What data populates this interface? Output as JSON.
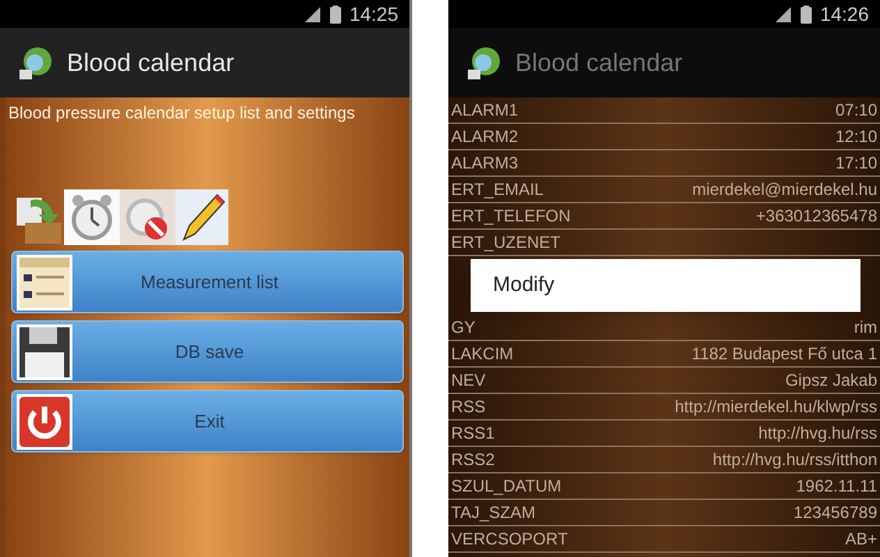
{
  "left_screen": {
    "status_bar": {
      "time": "14:25"
    },
    "action_bar": {
      "title": "Blood calendar"
    },
    "subtitle": "Blood pressure calendar setup list and settings",
    "menu_buttons": [
      {
        "label": "Measurement list",
        "kind": "list"
      },
      {
        "label": "DB save",
        "kind": "save"
      },
      {
        "label": "Exit",
        "kind": "exit"
      }
    ]
  },
  "right_screen": {
    "status_bar": {
      "time": "14:26"
    },
    "action_bar": {
      "title": "Blood calendar"
    },
    "settings_rows": [
      {
        "key": "ALARM1",
        "value": "07:10"
      },
      {
        "key": "ALARM2",
        "value": "12:10"
      },
      {
        "key": "ALARM3",
        "value": "17:10"
      },
      {
        "key": "ERT_EMAIL",
        "value": "mierdekel@mierdekel.hu"
      },
      {
        "key": "ERT_TELEFON",
        "value": "+363012365478"
      },
      {
        "key": "ERT_UZENET"
      },
      {
        "key": "GY",
        "value": "rim"
      },
      {
        "key": "LAKCIM",
        "value": "1182 Budapest Fő utca 1"
      },
      {
        "key": "NEV",
        "value": "Gipsz Jakab"
      },
      {
        "key": "RSS",
        "value": "http://mierdekel.hu/klwp/rss"
      },
      {
        "key": "RSS1",
        "value": "http://hvg.hu/rss"
      },
      {
        "key": "RSS2",
        "value": "http://hvg.hu/rss/itthon"
      },
      {
        "key": "SZUL_DATUM",
        "value": "1962.11.11"
      },
      {
        "key": "TAJ_SZAM",
        "value": "123456789"
      },
      {
        "key": "VERCSOPORT",
        "value": "AB+"
      }
    ],
    "dialog": {
      "items": [
        "Modify"
      ]
    }
  }
}
